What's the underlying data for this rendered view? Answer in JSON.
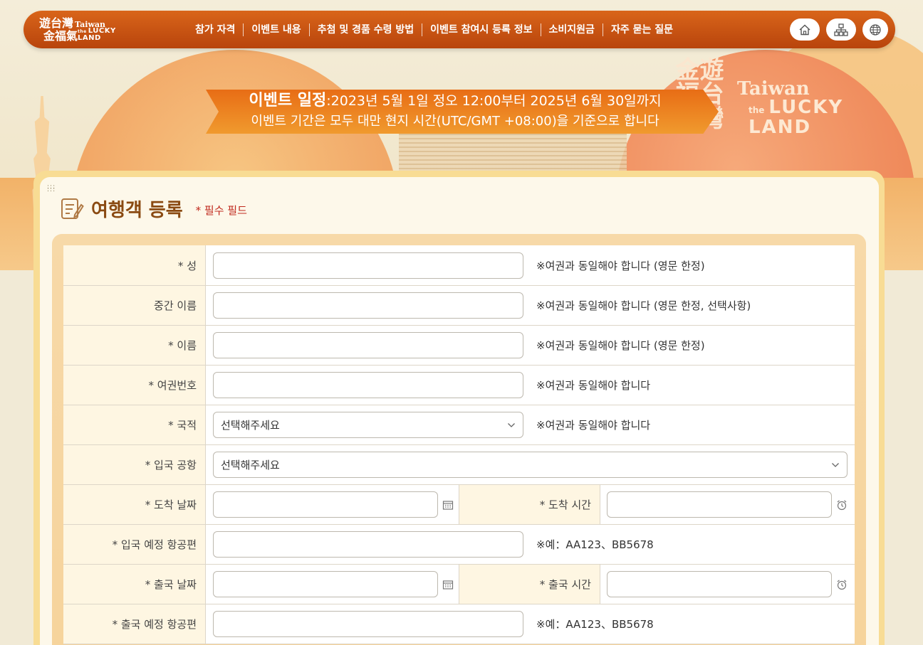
{
  "header": {
    "brand": {
      "zh_line1": "遊台灣",
      "zh_line2": "金福氣",
      "en_line1": "Taiwan",
      "en_the": "the",
      "en_line2": "LUCKY",
      "en_line3": "LAND"
    },
    "nav": [
      {
        "label": "참가 자격"
      },
      {
        "label": "이벤트 내용"
      },
      {
        "label": "추첨 및 경품 수령 방법"
      },
      {
        "label": "이벤트 참여시 등록 정보"
      },
      {
        "label": "소비지원금"
      },
      {
        "label": "자주 묻는 질문"
      }
    ],
    "buttons": [
      {
        "icon": "home-icon"
      },
      {
        "icon": "sitemap-icon"
      },
      {
        "icon": "globe-icon"
      }
    ],
    "colors": {
      "bar_top": "#d9651a",
      "bar_bottom": "#b8440c"
    }
  },
  "hero_logo": {
    "zh": "遊台灣金福氣",
    "en_line1": "Taiwan",
    "en_the": "the",
    "en_line2": "LUCKY",
    "en_line3": "LAND"
  },
  "banner": {
    "label": "이벤트 일정",
    "schedule": ":2023년 5월 1일 정오 12:00부터 2025년 6월 30일까지",
    "note": "이벤트 기간은 모두 대만 현지 시간(UTC/GMT +08:00)을 기준으로 합니다"
  },
  "form": {
    "title": "여행객 등록",
    "required_note": "* 필수 필드",
    "rows": [
      {
        "label": "* 성",
        "hint": "※여권과 동일해야 합니다 (영문 한정)"
      },
      {
        "label": "중간 이름",
        "hint": "※여권과 동일해야 합니다 (영문 한정, 선택사항)"
      },
      {
        "label": "* 이름",
        "hint": "※여권과 동일해야 합니다 (영문 한정)"
      },
      {
        "label": "* 여권번호",
        "hint": "※여권과 동일해야 합니다"
      },
      {
        "label": "* 국적",
        "select_value": "선택해주세요",
        "hint": "※여권과 동일해야 합니다"
      },
      {
        "label": "* 입국 공항",
        "select_value": "선택해주세요"
      },
      {
        "label": "* 도착 날짜",
        "time_label": "* 도착 시간"
      },
      {
        "label": "* 입국 예정 항공편",
        "hint": "※예：AA123、BB5678"
      },
      {
        "label": "* 출국 날짜",
        "time_label": "* 출국 시간"
      },
      {
        "label": "* 출국 예정 항공편",
        "hint": "※예：AA123、BB5678"
      }
    ]
  }
}
